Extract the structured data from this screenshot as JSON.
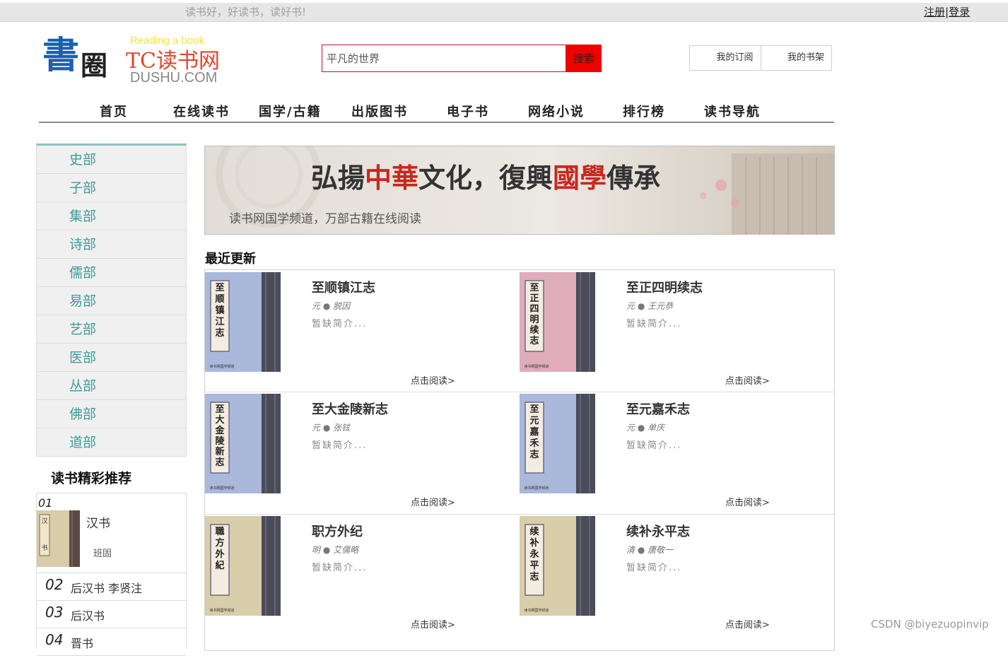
{
  "top": {
    "slogan": "读书好，好读书，读好书!",
    "register": "注册",
    "separator": "|",
    "login": "登录"
  },
  "logo": {
    "calligraphy": "書圈",
    "tagline": "Reading a book",
    "brand": "TC读书网",
    "domain": "DUSHU.COM"
  },
  "search": {
    "value": "平凡的世界",
    "button": "搜索"
  },
  "user": {
    "subscription": "我的订阅",
    "bookshelf": "我的书架"
  },
  "nav": [
    "首页",
    "在线读书",
    "国学/古籍",
    "出版图书",
    "电子书",
    "网络小说",
    "排行榜",
    "读书导航"
  ],
  "sidebar": {
    "categories": [
      "史部",
      "子部",
      "集部",
      "诗部",
      "儒部",
      "易部",
      "艺部",
      "医部",
      "丛部",
      "佛部",
      "道部"
    ],
    "recommend_title": "读书精彩推荐",
    "recommend": [
      {
        "num": "01",
        "title": "汉书",
        "author": "班固",
        "cover_text": "汉书"
      },
      {
        "num": "02",
        "title": "后汉书 李贤注"
      },
      {
        "num": "03",
        "title": "后汉书"
      },
      {
        "num": "04",
        "title": "晋书"
      }
    ]
  },
  "banner": {
    "headline_parts": [
      "弘揚",
      "中華",
      "文化，復興",
      "國學",
      "傳承"
    ],
    "subline": "读书网国学频道，万部古籍在线阅读",
    "accent_color": "#c8281e"
  },
  "recent": {
    "title": "最近更新",
    "read_label": "点击阅读>",
    "books": [
      {
        "title": "至顺镇江志",
        "author": "元 ● 脱因",
        "desc": "暂缺简介...",
        "cover_text": "至顺镇江志",
        "cover_color": "#aab8dc"
      },
      {
        "title": "至正四明续志",
        "author": "元 ● 王元恭",
        "desc": "暂缺简介...",
        "cover_text": "至正四明续志",
        "cover_color": "#dfadb9"
      },
      {
        "title": "至大金陵新志",
        "author": "元 ● 张铉",
        "desc": "暂缺简介...",
        "cover_text": "至大金陵新志",
        "cover_color": "#aab8dc"
      },
      {
        "title": "至元嘉禾志",
        "author": "元 ● 单庆",
        "desc": "暂缺简介...",
        "cover_text": "至元嘉禾志",
        "cover_color": "#aab8dc"
      },
      {
        "title": "职方外纪",
        "author": "明 ● 艾儒略",
        "desc": "暂缺简介...",
        "cover_text": "職方外紀",
        "cover_color": "#d9ceaa"
      },
      {
        "title": "续补永平志",
        "author": "清 ● 唐敬一",
        "desc": "暂缺简介...",
        "cover_text": "续补永平志",
        "cover_color": "#d9ceaa"
      }
    ],
    "cover_footer": "读书网国学频道"
  },
  "watermark": "CSDN @biyezuopinvip"
}
